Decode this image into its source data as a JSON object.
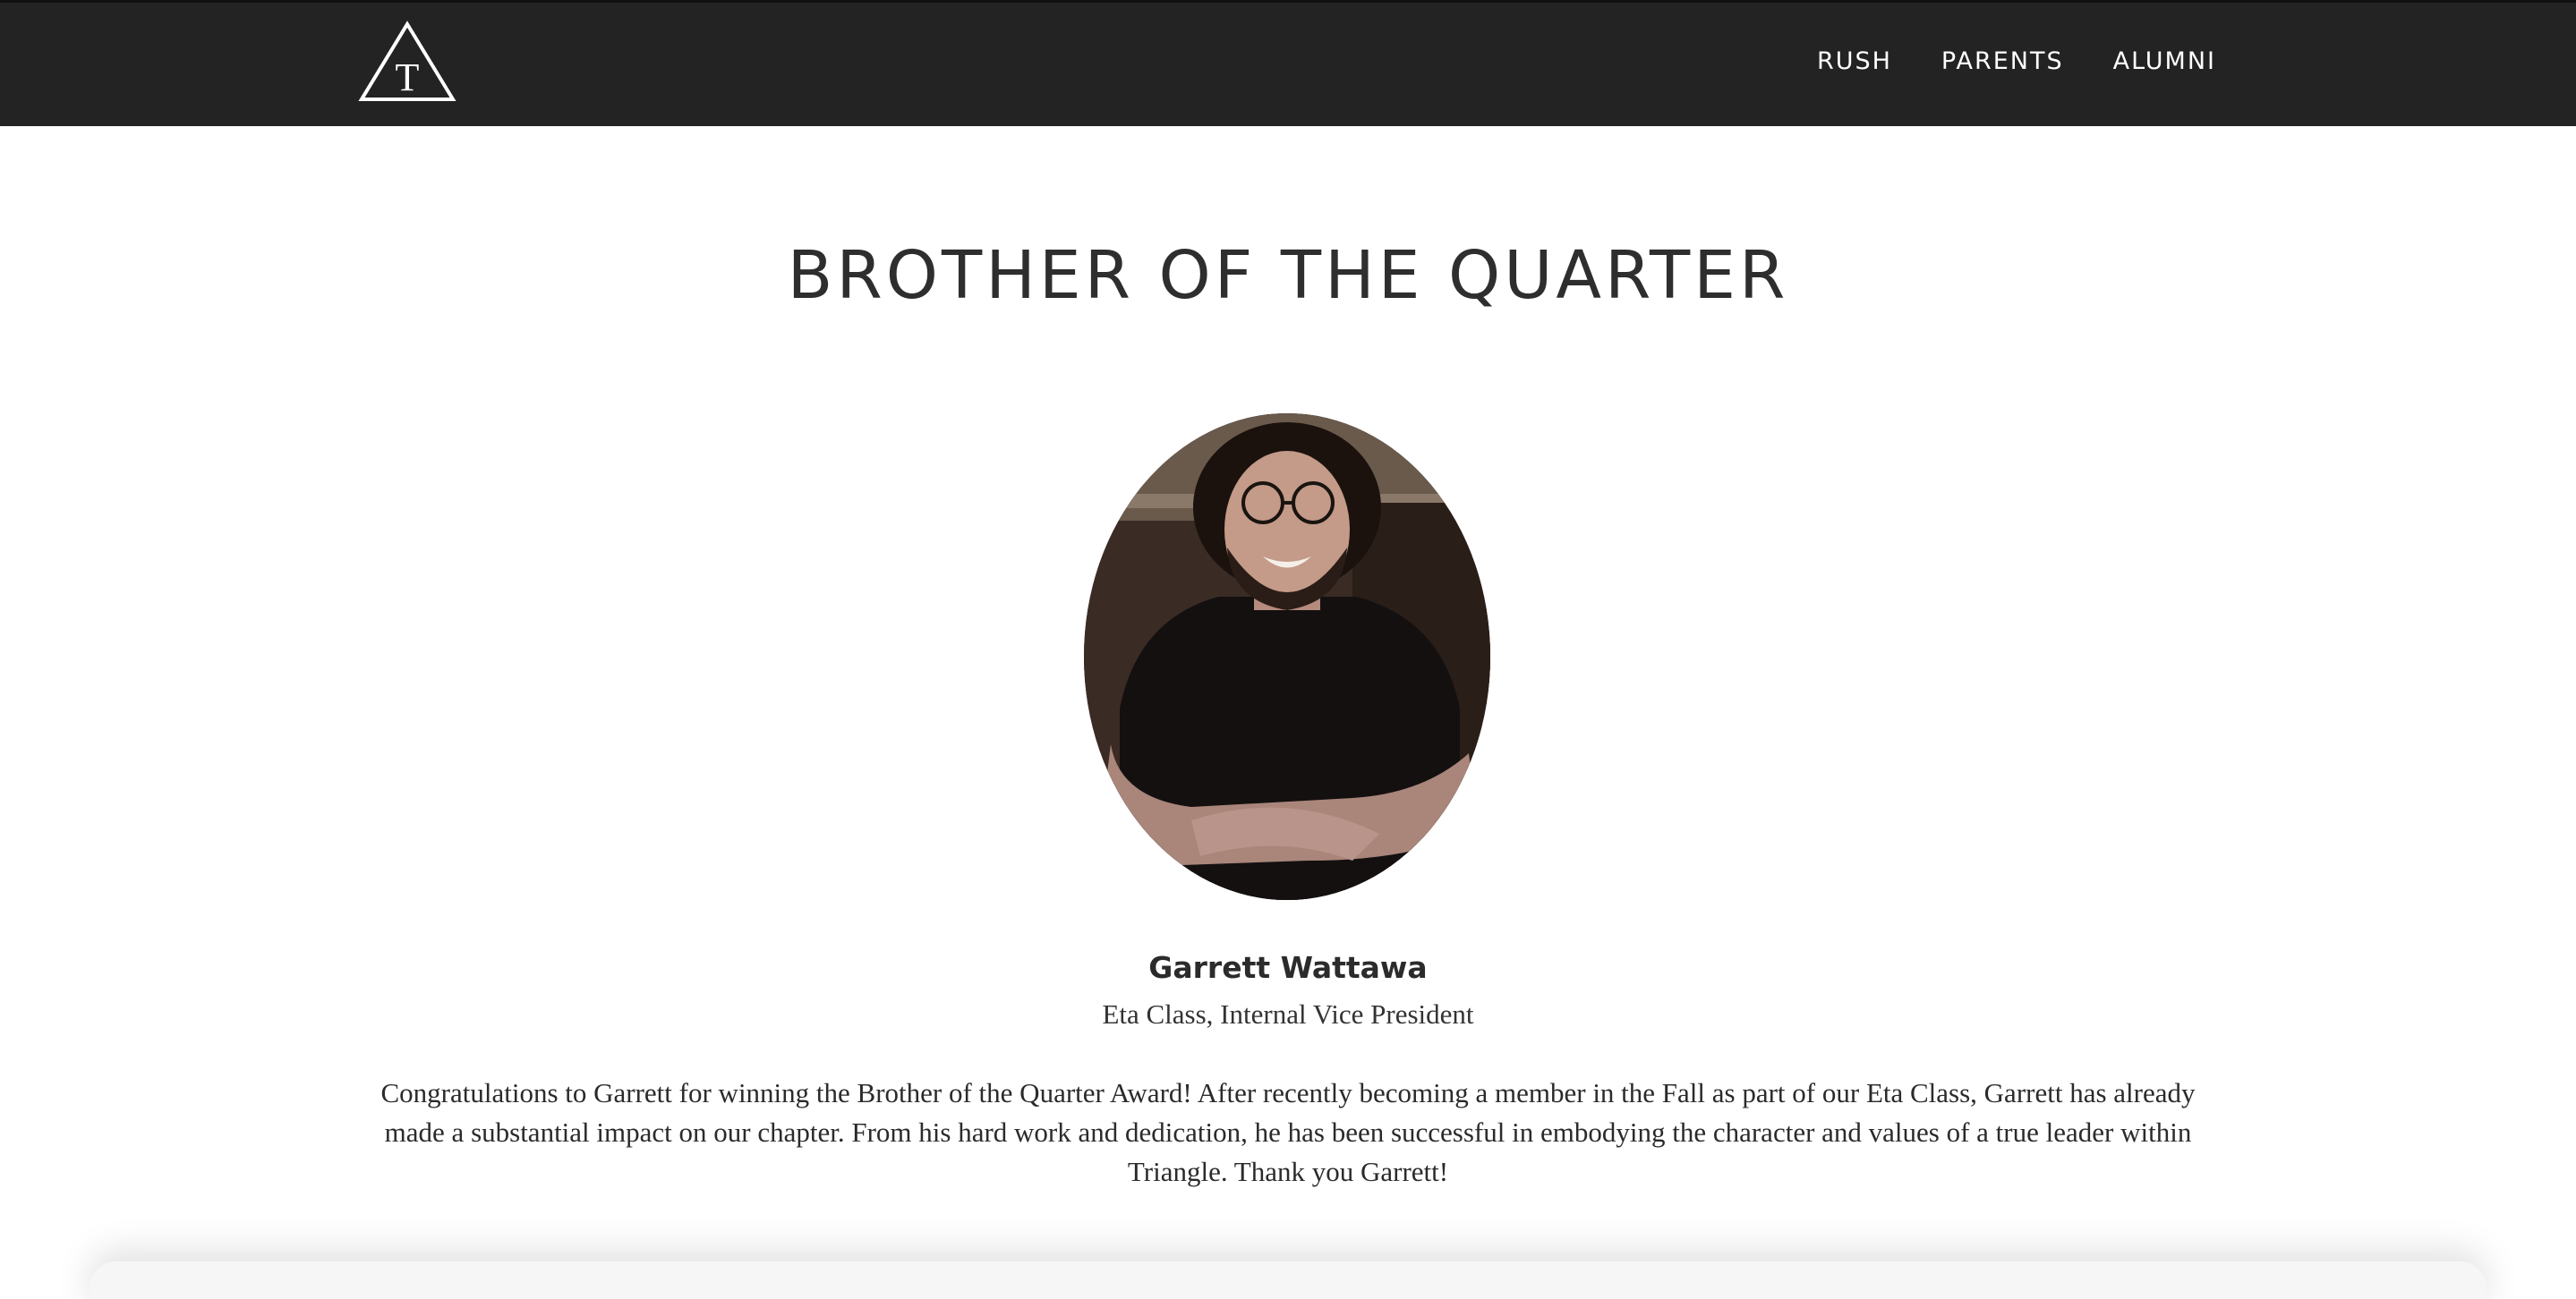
{
  "nav": {
    "logo_letter": "T",
    "links": [
      "RUSH",
      "PARENTS",
      "ALUMNI"
    ]
  },
  "main": {
    "title": "BROTHER OF THE QUARTER",
    "name": "Garrett Wattawa",
    "role": "Eta Class, Internal Vice President",
    "bio": "Congratulations to Garrett for winning the Brother of the Quarter Award! After recently becoming a member in the Fall as part of our Eta Class, Garrett has already made a substantial impact on our chapter. From his hard work and dedication, he has been successful in embodying the character and values of a true leader within Triangle. Thank you Garrett!"
  },
  "colors": {
    "navbar_bg": "#232323",
    "text_dark": "#2e2e2e",
    "nav_text": "#ffffff"
  }
}
